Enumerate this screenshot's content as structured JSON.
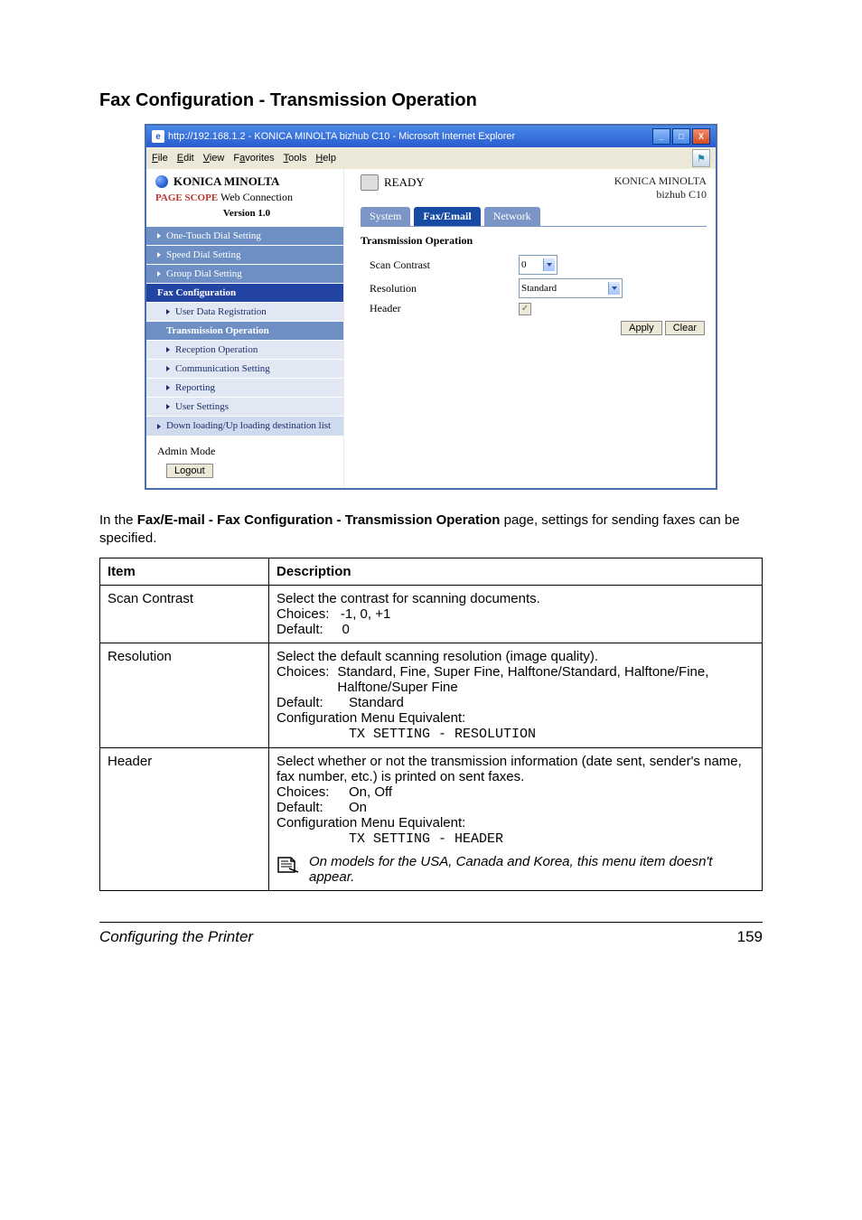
{
  "heading": "Fax Configuration - Transmission Operation",
  "ie": {
    "title": "http://192.168.1.2 - KONICA MINOLTA bizhub C10 - Microsoft Internet Explorer",
    "menus": [
      "File",
      "Edit",
      "View",
      "Favorites",
      "Tools",
      "Help"
    ]
  },
  "brand": {
    "name": "KONICA MINOLTA",
    "line2_prefix": "PAGE SCOPE",
    "line2": "Web Connection",
    "version": "Version 1.0"
  },
  "sidebar": {
    "items": [
      {
        "label": "One-Touch Dial Setting"
      },
      {
        "label": "Speed Dial Setting"
      },
      {
        "label": "Group Dial Setting"
      },
      {
        "label": "Fax Configuration"
      },
      {
        "label": "User Data Registration"
      },
      {
        "label": "Transmission Operation"
      },
      {
        "label": "Reception Operation"
      },
      {
        "label": "Communication Setting"
      },
      {
        "label": "Reporting"
      },
      {
        "label": "User Settings"
      }
    ],
    "download": "Down loading/Up loading destination list"
  },
  "rightPane": {
    "ready": "READY",
    "modelBrand": "KONICA MINOLTA",
    "modelName": "bizhub C10",
    "tabs": {
      "system": "System",
      "faxemail": "Fax/Email",
      "network": "Network"
    },
    "section": "Transmission Operation",
    "rows": {
      "scanContrastLabel": "Scan Contrast",
      "scanContrastValue": "0",
      "resolutionLabel": "Resolution",
      "resolutionValue": "Standard",
      "headerLabel": "Header"
    },
    "buttons": {
      "apply": "Apply",
      "clear": "Clear"
    }
  },
  "admin": {
    "label": "Admin Mode",
    "logout": "Logout"
  },
  "intro": {
    "prefix": "In the ",
    "bold": "Fax/E-mail - Fax Configuration - Transmission Operation",
    "suffix": " page, settings for sending faxes can be specified."
  },
  "table": {
    "headers": {
      "item": "Item",
      "desc": "Description"
    },
    "rows": [
      {
        "item": "Scan Contrast",
        "desc": {
          "l1": "Select the contrast for scanning documents.",
          "choicesLabel": "Choices:",
          "choices": "-1, 0, +1",
          "defaultLabel": "Default:",
          "def": "0"
        }
      },
      {
        "item": "Resolution",
        "desc": {
          "l1": "Select the default scanning resolution (image quality).",
          "choicesLabel": "Choices:",
          "choices": "Standard, Fine, Super Fine, Halftone/Standard, Halftone/Fine, Halftone/Super Fine",
          "defaultLabel": "Default:",
          "def": "Standard",
          "cfg": "Configuration Menu Equivalent:",
          "cfgVal": "TX SETTING - RESOLUTION"
        }
      },
      {
        "item": "Header",
        "desc": {
          "l1": "Select whether or not the transmission information (date sent, sender's name, fax number, etc.) is printed on sent faxes.",
          "choicesLabel": "Choices:",
          "choices": "On, Off",
          "defaultLabel": "Default:",
          "def": "On",
          "cfg": "Configuration Menu Equivalent:",
          "cfgVal": "TX SETTING - HEADER",
          "note": "On models for the USA, Canada and Korea, this menu item doesn't appear."
        }
      }
    ]
  },
  "footer": {
    "left": "Configuring the Printer",
    "right": "159"
  }
}
